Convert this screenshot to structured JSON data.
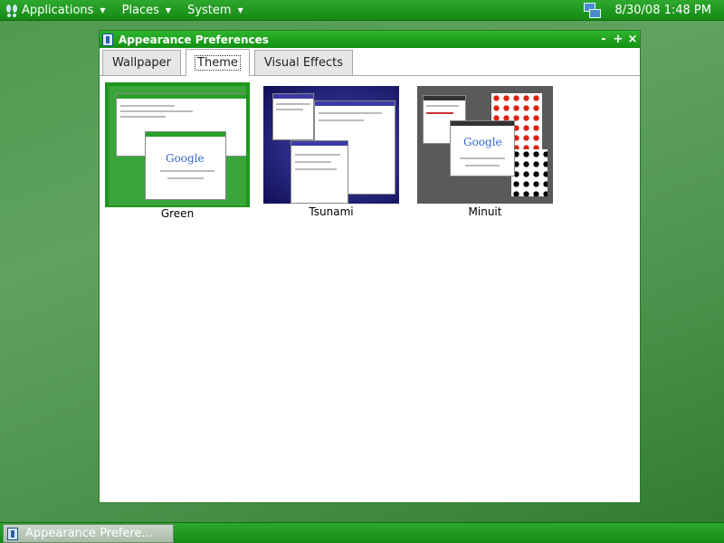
{
  "top_panel": {
    "menus": [
      "Applications",
      "Places",
      "System"
    ],
    "clock": "8/30/08 1:48 PM"
  },
  "window": {
    "title": "Appearance Preferences",
    "controls": {
      "minimize": "-",
      "maximize": "+",
      "close": "×"
    },
    "tabs": [
      {
        "label": "Wallpaper",
        "active": false
      },
      {
        "label": "Theme",
        "active": true
      },
      {
        "label": "Visual Effects",
        "active": false
      }
    ],
    "themes": [
      {
        "name": "Green",
        "selected": true
      },
      {
        "name": "Tsunami",
        "selected": false
      },
      {
        "name": "Minuit",
        "selected": false
      }
    ],
    "preview_logo_text": "Google"
  },
  "taskbar": {
    "task_label": "Appearance Prefere..."
  },
  "colors": {
    "panel_green": "#1e961e",
    "desktop_green": "#4f9a4f",
    "tsunami_blue": "#1a1a7a",
    "minuit_gray": "#555555"
  }
}
